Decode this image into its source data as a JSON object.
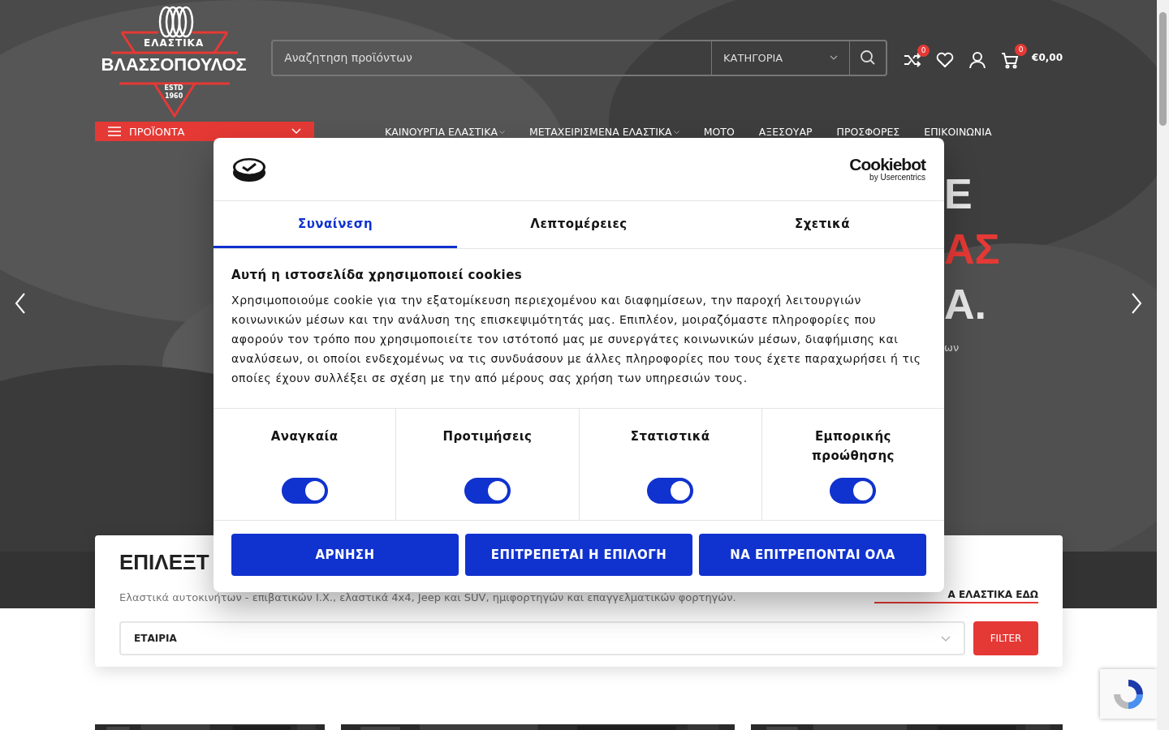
{
  "header": {
    "logo": {
      "line_1": "ΕΛΑΣΤΙΚΑ",
      "line_2": "ΒΛΑΣΣΟΠΟΥΛΟΣ",
      "line_3": "ESTD",
      "line_4": "1960"
    },
    "search": {
      "placeholder": "Αναζητηση προϊόντων",
      "category": "ΚΑΤΗΓΟΡΙΑ"
    },
    "compare_count": "0",
    "cart_count": "0",
    "cart_total": "€0,00"
  },
  "products_menu": "ΠΡΟΪΟΝΤΑ",
  "nav": [
    {
      "label": "ΚΑΙΝΟΥΡΓΙΑ ΕΛΑΣΤΙΚΑ",
      "has_dropdown": true
    },
    {
      "label": "ΜΕΤΑΧΕΙΡΙΣΜΕΝΑ ΕΛΑΣΤΙΚΑ",
      "has_dropdown": true
    },
    {
      "label": "ΜΟΤΟ",
      "has_dropdown": false
    },
    {
      "label": "ΑΞΕΣΟΥΑΡ",
      "has_dropdown": false
    },
    {
      "label": "ΠΡΟΣΦΟΡΕΣ",
      "has_dropdown": false
    },
    {
      "label": "ΕΠΙΚΟΙΝΩΝΙΑ",
      "has_dropdown": false
    }
  ],
  "hero": {
    "fragments": [
      {
        "text": "Ε",
        "kind": "plain"
      },
      {
        "text": "ΑΣ",
        "kind": "accent"
      },
      {
        "text": "Α.",
        "kind": "plain"
      },
      {
        "text": "ων",
        "kind": "small"
      }
    ]
  },
  "cookie_dialog": {
    "brand": "Cookiebot",
    "brand_sub": "by Usercentrics",
    "tabs": [
      {
        "label": "Συναίνεση",
        "selected": true
      },
      {
        "label": "Λεπτομέρειες",
        "selected": false
      },
      {
        "label": "Σχετικά",
        "selected": false
      }
    ],
    "title": "Αυτή η ιστοσελίδα χρησιμοποιεί cookies",
    "text": "Χρησιμοποιούμε cookie για την εξατομίκευση περιεχομένου και διαφημίσεων, την παροχή λειτουργιών κοινωνικών μέσων και την ανάλυση της επισκεψιμότητάς μας. Επιπλέον, μοιραζόμαστε πληροφορίες που αφορούν τον τρόπο που χρησιμοποιείτε τον ιστότοπό μας με συνεργάτες κοινωνικών μέσων, διαφήμισης και αναλύσεων, οι οποίοι ενδεχομένως να τις συνδυάσουν με άλλες πληροφορίες που τους έχετε παραχωρήσει ή τις οποίες έχουν συλλέξει σε σχέση με την από μέρους σας χρήση των υπηρεσιών τους.",
    "categories": [
      {
        "label": "Αναγκαία",
        "on": true
      },
      {
        "label": "Προτιμήσεις",
        "on": true
      },
      {
        "label": "Στατιστικά",
        "on": true
      },
      {
        "label": "Εμπορικής προώθησης",
        "on": true
      }
    ],
    "buttons": [
      "ΑΡΝΗΣΗ",
      "ΕΠΙΤΡΕΠΕΤΑΙ Η ΕΠΙΛΟΓΗ",
      "ΝΑ ΕΠΙΤΡΕΠΟΝΤΑΙ ΟΛΑ"
    ]
  },
  "filter": {
    "heading": "ΕΠΙΛΕΞΤ",
    "subtitle": "Ελαστικά αυτοκινήτων - επιβατικών Ι.Χ., ελαστικά 4x4, Jeep και SUV, ημιφορτηγών και επαγγελματικών φορτηγών.",
    "link": "Α ΕΛΑΣΤΙΚΑ ΕΔΩ",
    "select": "ΕΤΑΙΡΙΑ",
    "button": "FILTER"
  }
}
